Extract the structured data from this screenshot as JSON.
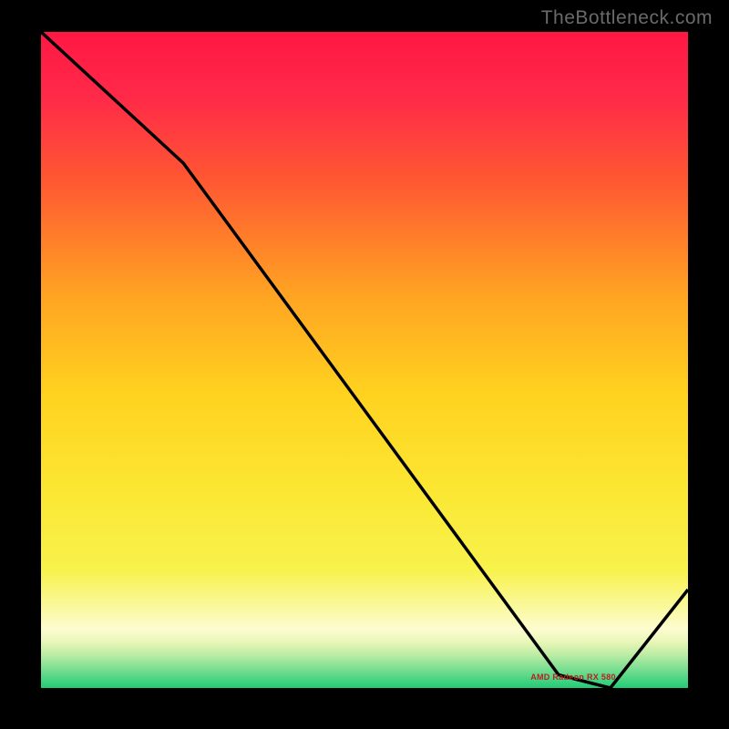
{
  "attribution": "TheBottleneck.com",
  "chart_data": {
    "type": "line",
    "title": "",
    "xlabel": "",
    "ylabel": "",
    "xlim": [
      0,
      100
    ],
    "ylim": [
      0,
      100
    ],
    "series": [
      {
        "name": "bottleneck-curve",
        "x": [
          0,
          22,
          80,
          88,
          100
        ],
        "y": [
          100,
          80,
          2,
          0,
          15
        ]
      }
    ],
    "annotations": [
      {
        "text": "AMD Radeon RX 580",
        "x": 82,
        "y": 1
      }
    ],
    "gradient_bands": [
      {
        "pos": 0.0,
        "color": "#ff1744"
      },
      {
        "pos": 0.1,
        "color": "#ff2a48"
      },
      {
        "pos": 0.22,
        "color": "#ff5533"
      },
      {
        "pos": 0.4,
        "color": "#ffa322"
      },
      {
        "pos": 0.55,
        "color": "#ffd21f"
      },
      {
        "pos": 0.7,
        "color": "#fbe733"
      },
      {
        "pos": 0.82,
        "color": "#f8f24c"
      },
      {
        "pos": 0.88,
        "color": "#faf9a2"
      },
      {
        "pos": 0.91,
        "color": "#fdfcd0"
      },
      {
        "pos": 0.93,
        "color": "#e9f6b8"
      },
      {
        "pos": 0.95,
        "color": "#baeca4"
      },
      {
        "pos": 0.97,
        "color": "#7ddf93"
      },
      {
        "pos": 1.0,
        "color": "#22cc77"
      }
    ]
  }
}
